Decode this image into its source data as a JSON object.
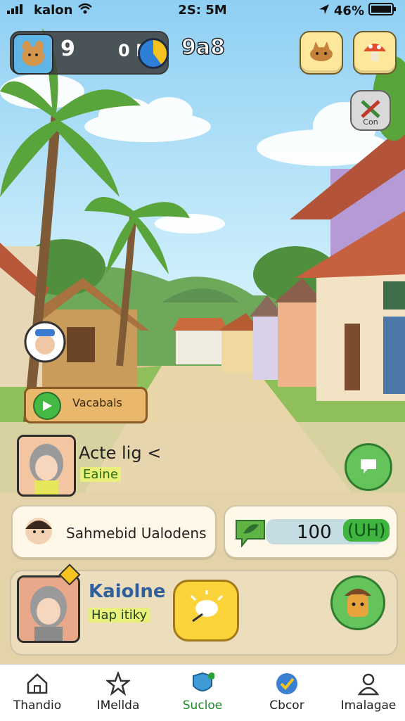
{
  "status_bar": {
    "carrier": "kalon",
    "time": "2S: 5M",
    "battery": "46%"
  },
  "hud": {
    "level": "9",
    "mid_text": "0 I",
    "coins": "9a8"
  },
  "side_button": {
    "label": "Con"
  },
  "scene": {
    "play_sign_label": "Vacabals"
  },
  "quest": {
    "title": "Acte lig <",
    "subtitle": "Eaine"
  },
  "chat_pill": {
    "text": "Sahmebid Ualodens"
  },
  "progress_pill": {
    "value": "100",
    "badge": "(UH)"
  },
  "player": {
    "name": "Kaiolne",
    "tag": "Hap itiky"
  },
  "nav": {
    "items": [
      {
        "label": "Thandio",
        "icon": "home-icon"
      },
      {
        "label": "IMellda",
        "icon": "star-icon"
      },
      {
        "label": "Sucloe",
        "icon": "shield-icon",
        "active": true
      },
      {
        "label": "Cbcor",
        "icon": "check-icon"
      },
      {
        "label": "Imalagae",
        "icon": "user-icon"
      }
    ]
  },
  "colors": {
    "accent_green": "#3fa63a",
    "nav_active": "#1f8a2a",
    "panel": "#e6d5af",
    "button_yellow": "#fde79a"
  }
}
